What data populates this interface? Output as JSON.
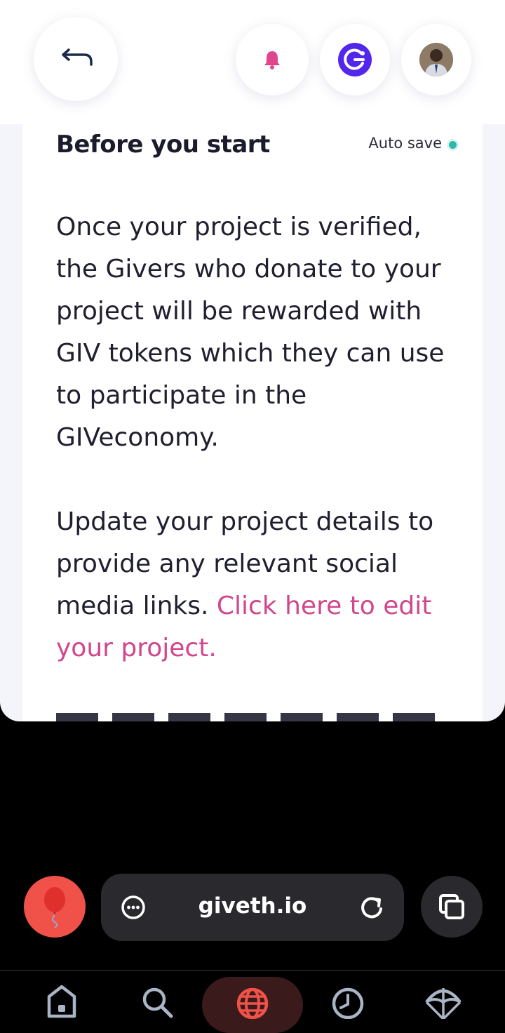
{
  "header": {
    "icons": [
      "back-arrow-icon",
      "bell-icon",
      "giv-token-icon",
      "avatar"
    ]
  },
  "card": {
    "title": "Before you start",
    "autosave_label": "Auto save",
    "paragraph1": "Once your project is verified, the Givers who donate to your project will be rewarded with GIV tokens which they can use to participate in the GIVeconomy.",
    "paragraph2_text": "Update your project details to provide any relevant social media links. ",
    "paragraph2_link": "Click here to edit your project."
  },
  "browser": {
    "url": "giveth.io"
  },
  "colors": {
    "accent_pink": "#d1468c",
    "giv_purple": "#5326ec",
    "autosave_green": "#2eb8a8",
    "balloon_red": "#f0524a"
  },
  "bottom_nav": [
    "home-icon",
    "search-icon",
    "globe-icon",
    "history-icon",
    "parachute-icon"
  ]
}
